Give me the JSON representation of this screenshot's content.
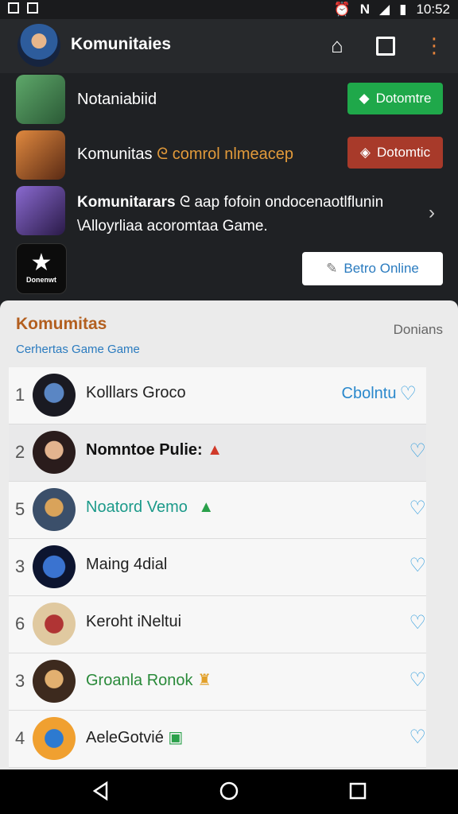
{
  "status": {
    "time": "10:52"
  },
  "app": {
    "title": "Komunitaies"
  },
  "featured": [
    {
      "text": "Notaniabiid",
      "button": "Dotomtre",
      "button_color": "#1fa84a",
      "text_color": "#d8e87a"
    },
    {
      "text": "Komunitas",
      "accent": "ᘓ comrol nlmeacep",
      "button": "Dotomtic",
      "button_color": "#a83a2a"
    },
    {
      "title": "Komunitarars",
      "desc1": "ᘓ aap fofoin ondocenaotlflunin",
      "desc2": "\\Alloyrliaa acoromtaa Game."
    },
    {
      "thumb_label": "Donenwt",
      "button": "Betro Online"
    }
  ],
  "section": {
    "title": "Komumitas",
    "subtitle": "Cerhertas Game Game",
    "right": "Donians"
  },
  "items": [
    {
      "rank": "1",
      "name": "Kolllars Groco",
      "action": "Cbolntu"
    },
    {
      "rank": "2",
      "name": "Nomntoe Pulie:",
      "badge": "▲"
    },
    {
      "rank": "5",
      "name": "Noatord Vemo",
      "badge": "▲"
    },
    {
      "rank": "3",
      "name": "Maing 4dial"
    },
    {
      "rank": "6",
      "name": "Keroht iNeltui"
    },
    {
      "rank": "3",
      "name": "Groanla Ronok"
    },
    {
      "rank": "4",
      "name": "AeleGotvié"
    }
  ],
  "colors": {
    "accent_orange": "#b35f1f",
    "link_blue": "#2a7bbf",
    "heart_blue": "#3aa0dd"
  }
}
